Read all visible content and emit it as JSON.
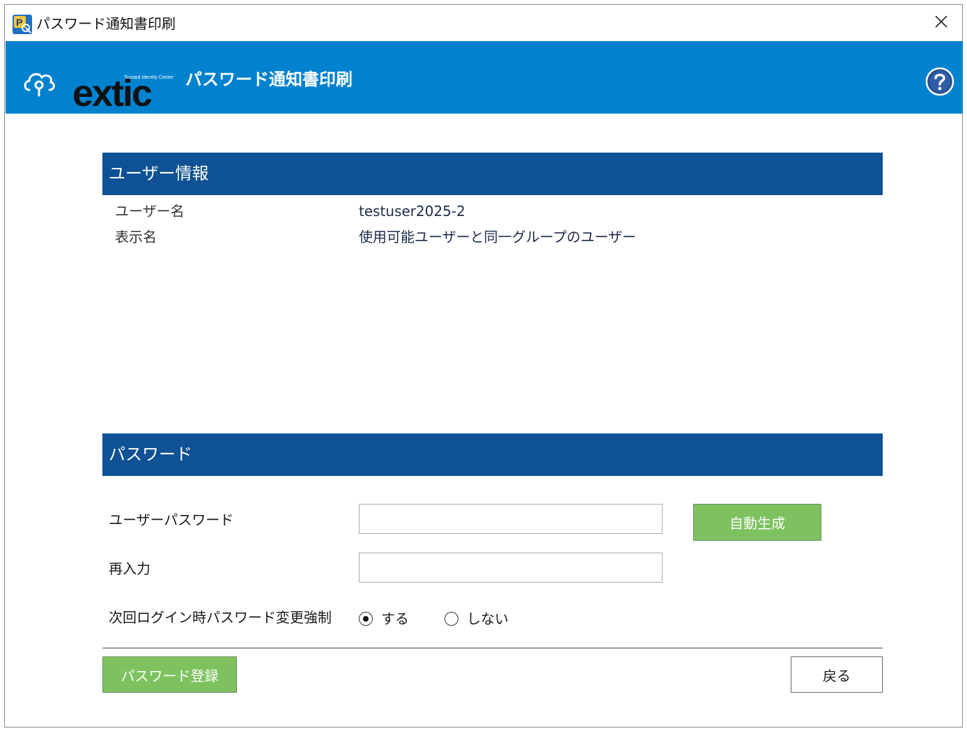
{
  "window": {
    "title": "パスワード通知書印刷"
  },
  "header": {
    "logo_word": "extic",
    "logo_tagline": "Trusted Identity Center",
    "title": "パスワード通知書印刷"
  },
  "user_info": {
    "section_title": "ユーザー情報",
    "username_label": "ユーザー名",
    "username_value": "testuser2025-2",
    "display_name_label": "表示名",
    "display_name_value": "使用可能ユーザーと同一グループのユーザー"
  },
  "password": {
    "section_title": "パスワード",
    "user_password_label": "ユーザーパスワード",
    "user_password_value": "",
    "auto_generate_label": "自動生成",
    "reenter_label": "再入力",
    "reenter_value": "",
    "force_change_label": "次回ログイン時パスワード変更強制",
    "force_change_options": [
      "する",
      "しない"
    ],
    "force_change_selected": "する"
  },
  "footer": {
    "register_label": "パスワード登録",
    "back_label": "戻る"
  },
  "colors": {
    "header_blue": "#0082cf",
    "section_blue": "#0e5194",
    "button_green": "#7dc25f"
  },
  "icons": {
    "app": "password-app-icon",
    "close": "close-icon",
    "help": "help-icon",
    "logo": "cloud-key-icon"
  }
}
